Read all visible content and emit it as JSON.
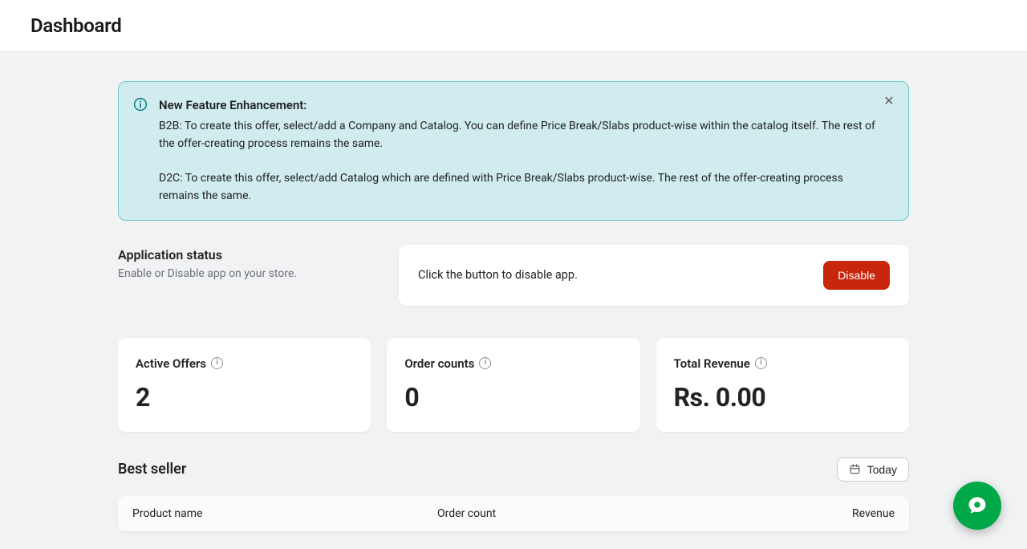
{
  "header": {
    "title": "Dashboard"
  },
  "banner": {
    "title": "New Feature Enhancement:",
    "b2b": "B2B: To create this offer, select/add a Company and Catalog. You can define Price Break/Slabs product-wise within the catalog itself. The rest of the offer-creating process remains the same.",
    "d2c": "D2C: To create this offer, select/add Catalog which are defined with Price Break/Slabs product-wise. The rest of the offer-creating process remains the same."
  },
  "app_status": {
    "heading": "Application status",
    "sub": "Enable or Disable app on your store.",
    "card_text": "Click the button to disable app.",
    "button": "Disable"
  },
  "stats": {
    "active_offers": {
      "label": "Active Offers",
      "value": "2"
    },
    "order_counts": {
      "label": "Order counts",
      "value": "0"
    },
    "total_revenue": {
      "label": "Total Revenue",
      "value": "Rs. 0.00"
    }
  },
  "bestseller": {
    "heading": "Best seller",
    "date_label": "Today",
    "columns": {
      "product": "Product name",
      "order": "Order count",
      "revenue": "Revenue"
    }
  }
}
